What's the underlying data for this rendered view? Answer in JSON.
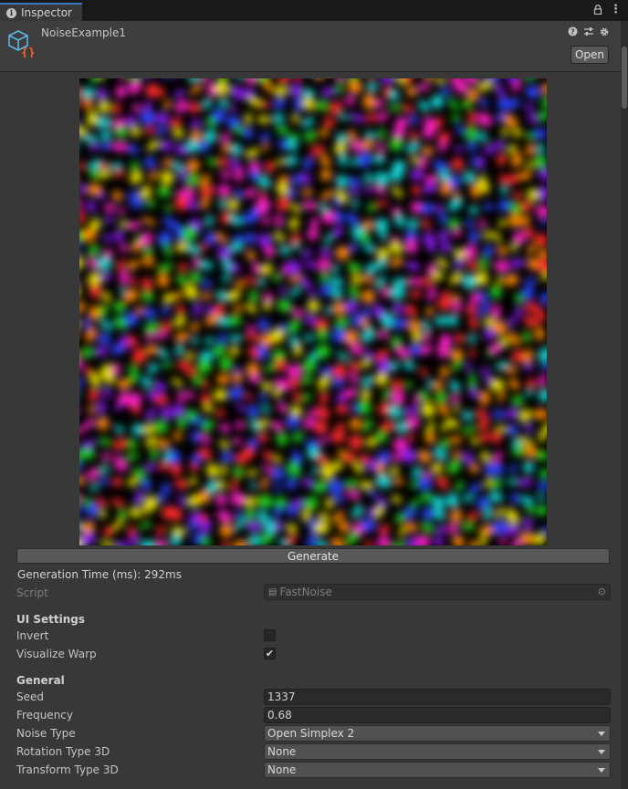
{
  "tab": {
    "title": "Inspector"
  },
  "header": {
    "asset_name": "NoiseExample1",
    "open_label": "Open"
  },
  "preview": {
    "icon": "noise-texture",
    "colors": [
      "#ff2a2a",
      "#ff8a00",
      "#e8e000",
      "#24d41a",
      "#19d6d6",
      "#2a44ff",
      "#8a1cf0",
      "#ff22c8"
    ]
  },
  "actions": {
    "generate_label": "Generate",
    "generation_time": "Generation Time (ms): 292ms"
  },
  "script_row": {
    "label": "Script",
    "value": "FastNoise"
  },
  "ui_settings": {
    "title": "UI Settings",
    "invert": {
      "label": "Invert",
      "checked": false
    },
    "visualize_warp": {
      "label": "Visualize Warp",
      "checked": true
    }
  },
  "general": {
    "title": "General",
    "seed": {
      "label": "Seed",
      "value": "1337"
    },
    "frequency": {
      "label": "Frequency",
      "value": "0.68"
    },
    "noise_type": {
      "label": "Noise Type",
      "value": "Open Simplex 2"
    },
    "rotation_type": {
      "label": "Rotation Type 3D",
      "value": "None"
    },
    "transform_type": {
      "label": "Transform Type 3D",
      "value": "None"
    }
  },
  "icons": {
    "check": "✔"
  }
}
